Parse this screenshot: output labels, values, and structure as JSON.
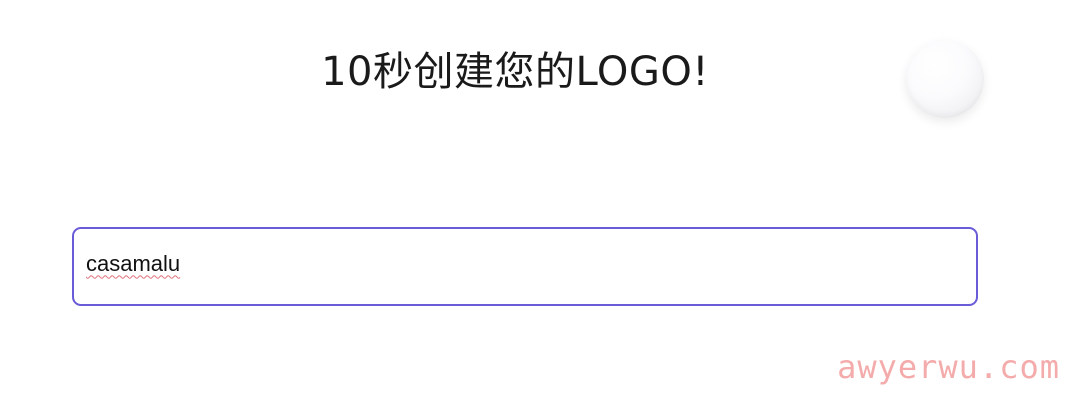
{
  "header": {
    "title": "10秒创建您的LOGO!"
  },
  "form": {
    "brand_name_value": "casamalu"
  },
  "watermark": {
    "text": "awyerwu.com"
  },
  "colors": {
    "input_border": "#6a5bd8",
    "watermark": "#f4a7a7",
    "title_text": "#1a1a1a"
  }
}
